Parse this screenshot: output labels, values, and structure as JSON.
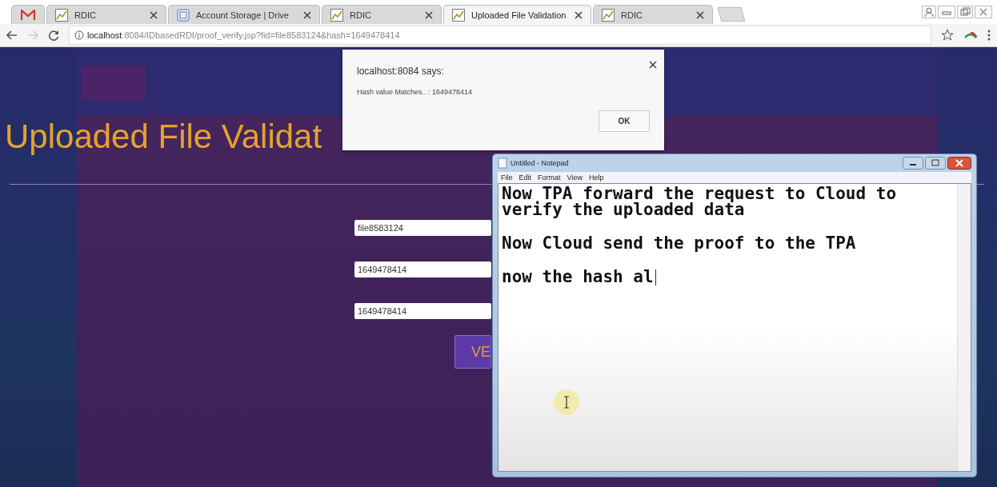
{
  "browser": {
    "tabs": [
      {
        "kind": "mail",
        "selected": false
      },
      {
        "kind": "page",
        "label": "RDIC",
        "selected": false
      },
      {
        "kind": "drive",
        "label": "Account Storage | Drive",
        "selected": false
      },
      {
        "kind": "page",
        "label": "RDIC",
        "selected": false
      },
      {
        "kind": "page",
        "label": "Uploaded File Validation",
        "selected": true
      },
      {
        "kind": "page",
        "label": "RDIC",
        "selected": false
      }
    ],
    "address": {
      "host": "localhost",
      "rest": ":8084/IDbasedRDI/proof_verify.jsp?fid=file8583124&hash=1649478414"
    }
  },
  "page": {
    "title": "Uploaded File Validat",
    "fields": [
      {
        "value": "file8583124"
      },
      {
        "value": "1649478414"
      },
      {
        "value": "1649478414"
      }
    ],
    "button": "VE"
  },
  "dialog": {
    "title": "localhost:8084 says:",
    "message": "Hash value Matches.. : 1649478414",
    "ok": "OK"
  },
  "notepad": {
    "title": "Untitled - Notepad",
    "menu": [
      "File",
      "Edit",
      "Format",
      "View",
      "Help"
    ],
    "paragraphs": [
      "Now TPA forward the request to Cloud to verify the uploaded data",
      "Now Cloud send the proof to the TPA",
      "now the hash al"
    ]
  }
}
